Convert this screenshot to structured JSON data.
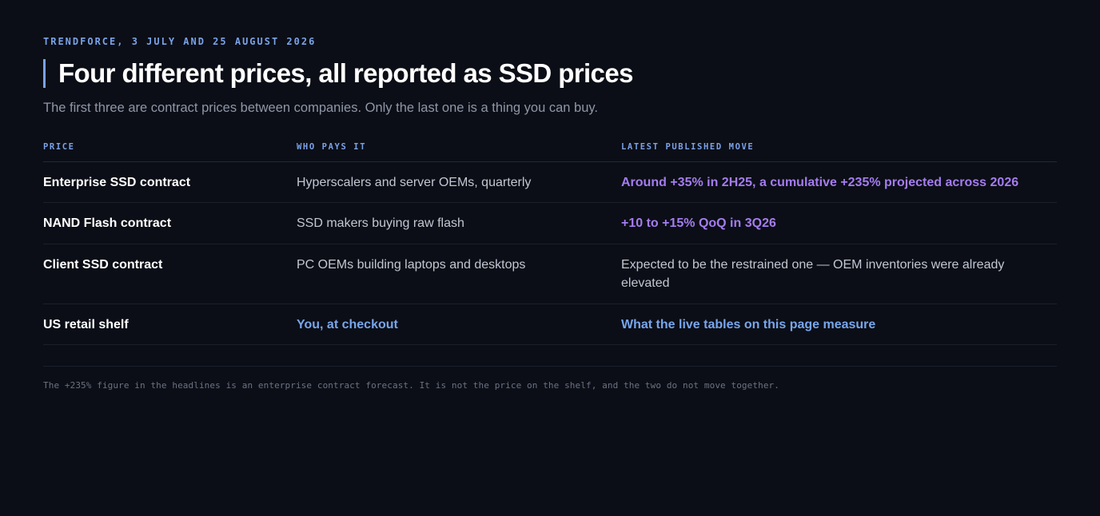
{
  "header": {
    "kicker": "TRENDFORCE, 3 JULY AND 25 AUGUST 2026",
    "title": "Four different prices, all reported as SSD prices",
    "subtitle": "The first three are contract prices between companies. Only the last one is a thing you can buy."
  },
  "table": {
    "columns": [
      "PRICE",
      "WHO PAYS IT",
      "LATEST PUBLISHED MOVE"
    ],
    "rows": [
      {
        "price": "Enterprise SSD contract",
        "who": "Hyperscalers and server OEMs, quarterly",
        "move": "Around +35% in 2H25, a cumulative +235% projected across 2026",
        "move_style": "purple"
      },
      {
        "price": "NAND Flash contract",
        "who": "SSD makers buying raw flash",
        "move": "+10 to +15% QoQ in 3Q26",
        "move_style": "purple"
      },
      {
        "price": "Client SSD contract",
        "who": "PC OEMs building laptops and desktops",
        "move": "Expected to be the restrained one — OEM inventories were already elevated",
        "move_style": "plain"
      },
      {
        "price": "US retail shelf",
        "who": "You, at checkout",
        "move": "What the live tables on this page measure",
        "move_style": "blue"
      }
    ]
  },
  "footnote": "The +235% figure in the headlines is an enterprise contract forecast. It is not the price on the shelf, and the two do not move together.",
  "colors": {
    "background": "#0b0e16",
    "accent_blue": "#7aa2e8",
    "accent_purple": "#a57cf0"
  }
}
